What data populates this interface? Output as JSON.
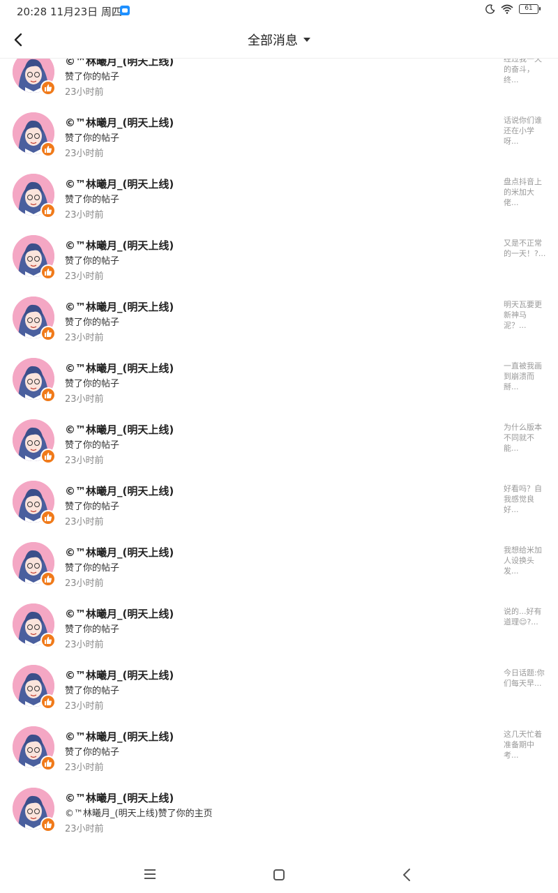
{
  "status_bar": {
    "time": "20:28 11月23日 周四",
    "battery": "61",
    "icons": [
      "message-app-icon",
      "moon-icon",
      "wifi-icon",
      "battery-icon"
    ]
  },
  "header": {
    "title": "全部消息",
    "back_icon": "back-arrow-icon",
    "dropdown_icon": "chevron-down-icon"
  },
  "messages": [
    {
      "name": "©™林曦月_(明天上线)",
      "action": "赞了你的帖子",
      "time": "23小时前",
      "preview": "经过我一天的奋斗，终..."
    },
    {
      "name": "©™林曦月_(明天上线)",
      "action": "赞了你的帖子",
      "time": "23小时前",
      "preview": "话说你们谁还在小学呀..."
    },
    {
      "name": "©™林曦月_(明天上线)",
      "action": "赞了你的帖子",
      "time": "23小时前",
      "preview": "盘点抖音上的米加大佬..."
    },
    {
      "name": "©™林曦月_(明天上线)",
      "action": "赞了你的帖子",
      "time": "23小时前",
      "preview": "又是不正常的一天！?..."
    },
    {
      "name": "©™林曦月_(明天上线)",
      "action": "赞了你的帖子",
      "time": "23小时前",
      "preview": "明天瓦要更新神马泥？..."
    },
    {
      "name": "©™林曦月_(明天上线)",
      "action": "赞了你的帖子",
      "time": "23小时前",
      "preview": "一直被我画到崩溃而掰..."
    },
    {
      "name": "©™林曦月_(明天上线)",
      "action": "赞了你的帖子",
      "time": "23小时前",
      "preview": "为什么版本不同就不能..."
    },
    {
      "name": "©™林曦月_(明天上线)",
      "action": "赞了你的帖子",
      "time": "23小时前",
      "preview": "好看吗？自我感觉良好..."
    },
    {
      "name": "©™林曦月_(明天上线)",
      "action": "赞了你的帖子",
      "time": "23小时前",
      "preview": "我想给米加人设换头发..."
    },
    {
      "name": "©™林曦月_(明天上线)",
      "action": "赞了你的帖子",
      "time": "23小时前",
      "preview": "说的...好有道理😌?..."
    },
    {
      "name": "©™林曦月_(明天上线)",
      "action": "赞了你的帖子",
      "time": "23小时前",
      "preview": "今日话题:你们每天早..."
    },
    {
      "name": "©™林曦月_(明天上线)",
      "action": "赞了你的帖子",
      "time": "23小时前",
      "preview": "这几天忙着准备期中考..."
    },
    {
      "name": "©™林曦月_(明天上线)",
      "action": "©™林曦月_(明天上线)赞了你的主页",
      "time": "23小时前",
      "preview": ""
    }
  ],
  "nav_bar": {
    "icons": [
      "menu-icon",
      "home-square-icon",
      "back-triangle-icon"
    ]
  },
  "colors": {
    "accent_like": "#f07a1a",
    "avatar_bg": "#f4a7c4",
    "text_primary": "#222222",
    "text_secondary": "#888888",
    "preview_text": "#999999"
  }
}
